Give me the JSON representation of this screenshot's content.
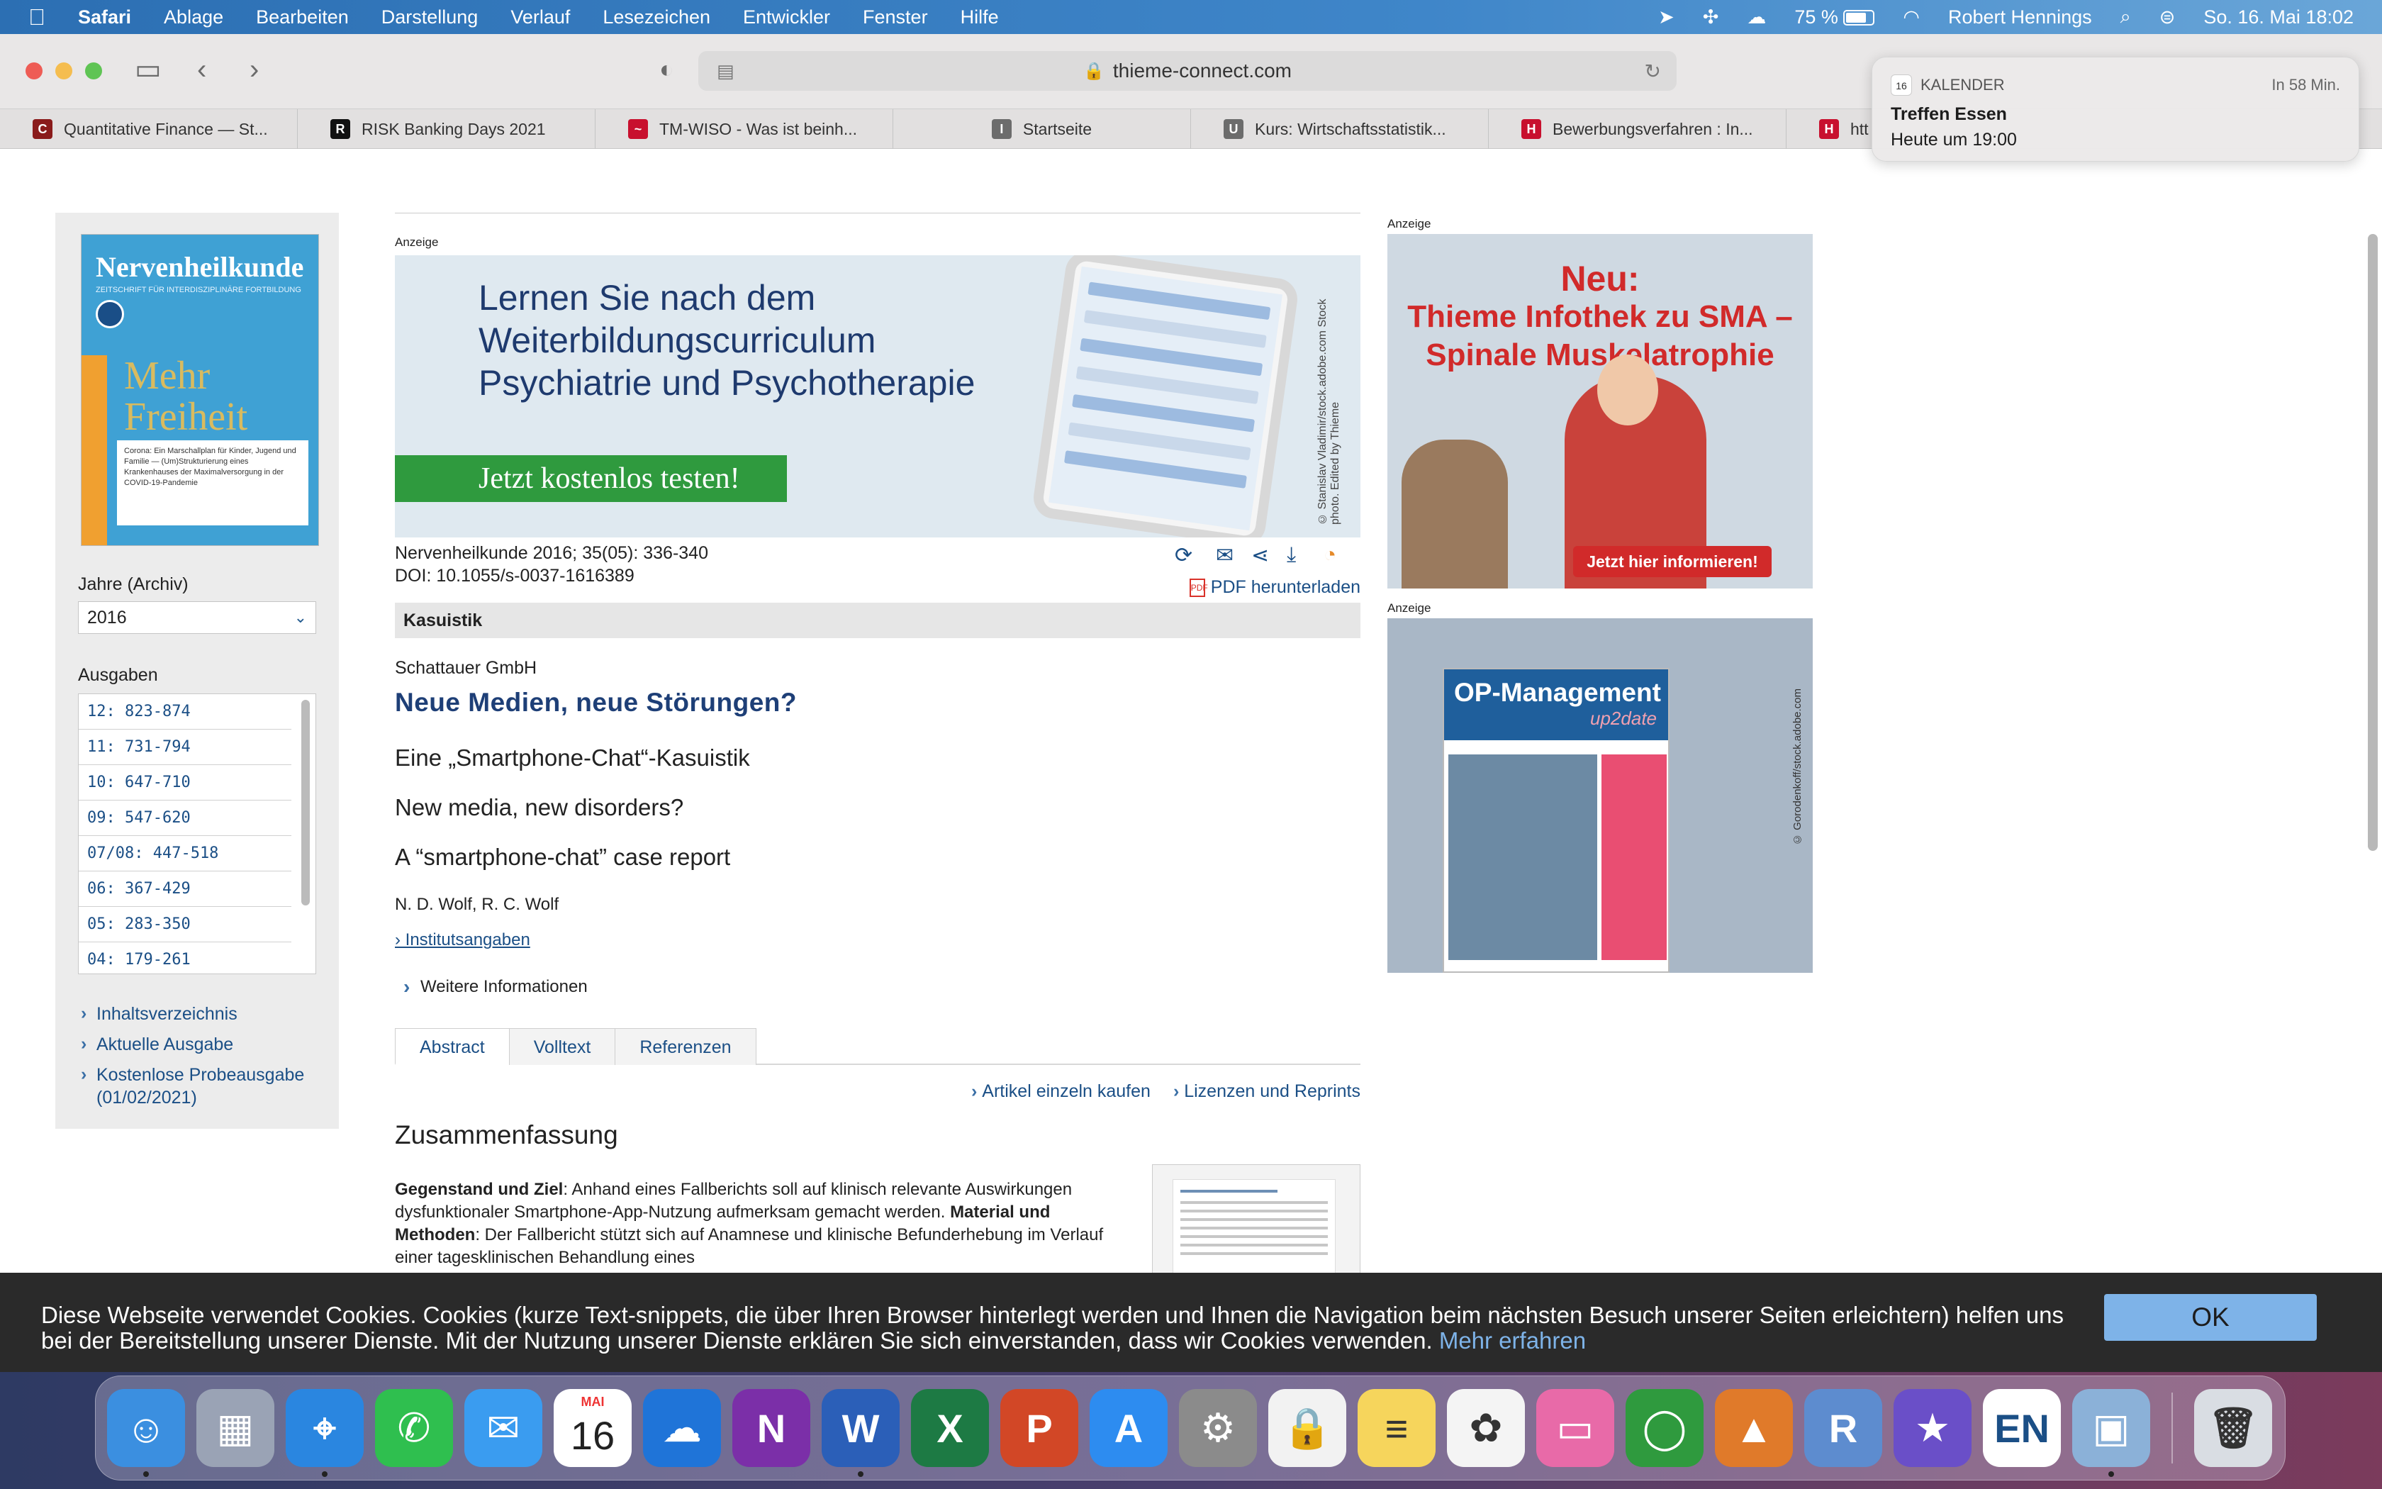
{
  "menubar": {
    "apple_icon": "apple-logo-icon",
    "items": [
      "Safari",
      "Ablage",
      "Bearbeiten",
      "Darstellung",
      "Verlauf",
      "Lesezeichen",
      "Entwickler",
      "Fenster",
      "Hilfe"
    ],
    "battery": "75 %",
    "user": "Robert Hennings",
    "datetime": "So. 16. Mai  18:02"
  },
  "toolbar": {
    "url": "thieme-connect.com"
  },
  "bookmarks": [
    {
      "label": "Quantitative Finance — St...",
      "color": "#8a1b1b",
      "glyph": "C"
    },
    {
      "label": "RISK Banking Days 2021",
      "color": "#111111",
      "glyph": "R"
    },
    {
      "label": "TM-WISO - Was ist beinh...",
      "color": "#c8102e",
      "glyph": "~"
    },
    {
      "label": "Startseite",
      "color": "#6c6c6c",
      "glyph": "I"
    },
    {
      "label": "Kurs: Wirtschaftsstatistik...",
      "color": "#6c6c6c",
      "glyph": "U"
    },
    {
      "label": "Bewerbungsverfahren : In...",
      "color": "#c8102e",
      "glyph": "H"
    },
    {
      "label": "htt",
      "color": "#c8102e",
      "glyph": "H"
    }
  ],
  "notification": {
    "app": "KALENDER",
    "time": "In 58 Min.",
    "title": "Treffen Essen",
    "body": "Heute um 19:00",
    "icon_day": "16"
  },
  "sidebar": {
    "cover_title": "Nervenheilkunde",
    "cover_subtitle": "ZEITSCHRIFT FÜR INTERDISZIPLINÄRE FORTBILDUNG",
    "cover_word": "Mehr Freiheit",
    "cover_box": "Corona: Ein Marschallplan für Kinder, Jugend und Familie — (Um)Strukturierung eines Krankenhauses der Maximalversorgung in der COVID-19-Pandemie",
    "year_label": "Jahre (Archiv)",
    "year_value": "2016",
    "issues_label": "Ausgaben",
    "issues": [
      "12: 823-874",
      "11: 731-794",
      "10: 647-710",
      "09: 547-620",
      "07/08: 447-518",
      "06: 367-429",
      "05: 283-350",
      "04: 179-261"
    ],
    "links": [
      "Inhaltsverzeichnis",
      "Aktuelle Ausgabe",
      "Kostenlose Probeausgabe",
      "(01/02/2021)"
    ]
  },
  "main": {
    "ad_label": "Anzeige",
    "banner_lines": [
      "Lernen Sie nach dem",
      "Weiterbildungscurriculum",
      "Psychiatrie und Psychotherapie"
    ],
    "banner_button": "Jetzt kostenlos testen!",
    "banner_credit": "© Stanislav Vladimir/stock.adobe.com Stock photo. Edited by Thieme",
    "citation": "Nervenheilkunde 2016; 35(05): 336-340",
    "doi": "DOI: 10.1055/s-0037-1616389",
    "pdf_link": "PDF herunterladen",
    "section": "Kasuistik",
    "publisher": "Schattauer GmbH",
    "title": "Neue Medien, neue Störungen?",
    "subtitle_de": "Eine „Smartphone-Chat“-Kasuistik",
    "title_en": "New media, new disorders?",
    "subtitle_en": "A “smartphone-chat” case report",
    "authors": "N. D. Wolf, R. C. Wolf",
    "institution_link": "› Institutsangaben",
    "more_info": "Weitere Informationen",
    "tabs": [
      "Abstract",
      "Volltext",
      "Referenzen"
    ],
    "buy_links": [
      "Artikel einzeln kaufen",
      "Lizenzen und Reprints"
    ],
    "summary_heading": "Zusammenfassung",
    "abstract_label1": "Gegenstand und Ziel",
    "abstract_text1": ": Anhand eines Fallberichts soll auf klinisch relevante Auswirkungen dysfunktionaler Smartphone-App-Nutzung aufmerksam gemacht werden. ",
    "abstract_label2": "Material und Methoden",
    "abstract_text2": ": Der Fallbericht stützt sich auf Anamnese und klinische Befunderhebung im Verlauf einer tagesklinischen Behandlung eines"
  },
  "ads": {
    "ad1_label": "Anzeige",
    "ad1_head1": "Neu:",
    "ad1_head2": "Thieme Infothek zu SMA –",
    "ad1_head3": "Spinale Muskelatrophie",
    "ad1_button": "Jetzt hier informieren!",
    "ad2_label": "Anzeige",
    "ad2_title": "OP-Management",
    "ad2_sub": "up2date",
    "ad2_credit": "© Gorodenkoff/stock.adobe.com"
  },
  "cookie": {
    "text": "Diese Webseite verwendet Cookies. Cookies (kurze Text-snippets, die über Ihren Browser hinterlegt werden und Ihnen die Navigation beim nächsten Besuch unserer Seiten erleichtern) helfen uns bei der Bereitstellung unserer Dienste. Mit der Nutzung unserer Dienste erklären Sie sich einverstanden, dass wir Cookies verwenden. ",
    "more": "Mehr erfahren",
    "ok": "OK"
  },
  "dock": {
    "calendar_month": "MAI",
    "calendar_day": "16",
    "apps": [
      {
        "name": "finder-icon",
        "color": "#3b8fe0",
        "glyph": "☺",
        "running": true
      },
      {
        "name": "launchpad-icon",
        "color": "#9aa3b5",
        "glyph": "▦",
        "running": false
      },
      {
        "name": "safari-icon",
        "color": "#2a86e0",
        "glyph": "⌖",
        "running": true
      },
      {
        "name": "whatsapp-icon",
        "color": "#2fbf4f",
        "glyph": "✆",
        "running": false
      },
      {
        "name": "mail-icon",
        "color": "#3a9cf0",
        "glyph": "✉",
        "running": false
      },
      {
        "name": "calendar-icon",
        "color": "#ffffff",
        "glyph": "",
        "running": false
      },
      {
        "name": "onedrive-icon",
        "color": "#1f74d8",
        "glyph": "☁",
        "running": false
      },
      {
        "name": "onenote-icon",
        "color": "#7b2fa8",
        "glyph": "N",
        "running": false
      },
      {
        "name": "word-icon",
        "color": "#2b5fb8",
        "glyph": "W",
        "running": true
      },
      {
        "name": "excel-icon",
        "color": "#1d7a44",
        "glyph": "X",
        "running": false
      },
      {
        "name": "powerpoint-icon",
        "color": "#d24726",
        "glyph": "P",
        "running": false
      },
      {
        "name": "app-store-icon",
        "color": "#2d8cf0",
        "glyph": "A",
        "running": false
      },
      {
        "name": "system-preferences-icon",
        "color": "#8b8b8b",
        "glyph": "⚙",
        "running": false
      },
      {
        "name": "lock-icon",
        "color": "#f2f2f2",
        "glyph": "🔒",
        "running": false
      },
      {
        "name": "notes-icon",
        "color": "#f6d55c",
        "glyph": "≡",
        "running": false
      },
      {
        "name": "photos-icon",
        "color": "#f4f4f4",
        "glyph": "✿",
        "running": false
      },
      {
        "name": "keynote-icon",
        "color": "#e86aa8",
        "glyph": "▭",
        "running": false
      },
      {
        "name": "circle-app-icon",
        "color": "#2f9a3e",
        "glyph": "◯",
        "running": false
      },
      {
        "name": "matlab-icon",
        "color": "#e07a2a",
        "glyph": "▲",
        "running": false
      },
      {
        "name": "r-icon",
        "color": "#5d8ccf",
        "glyph": "R",
        "running": false
      },
      {
        "name": "imovie-icon",
        "color": "#6a4fc8",
        "glyph": "★",
        "running": false
      },
      {
        "name": "dictionary-icon",
        "color": "#ffffff",
        "glyph": "EN",
        "running": false
      },
      {
        "name": "preview-icon",
        "color": "#8bb1d8",
        "glyph": "▣",
        "running": true
      },
      {
        "name": "trash-icon",
        "color": "#d9dde3",
        "glyph": "🗑",
        "running": false
      }
    ]
  }
}
